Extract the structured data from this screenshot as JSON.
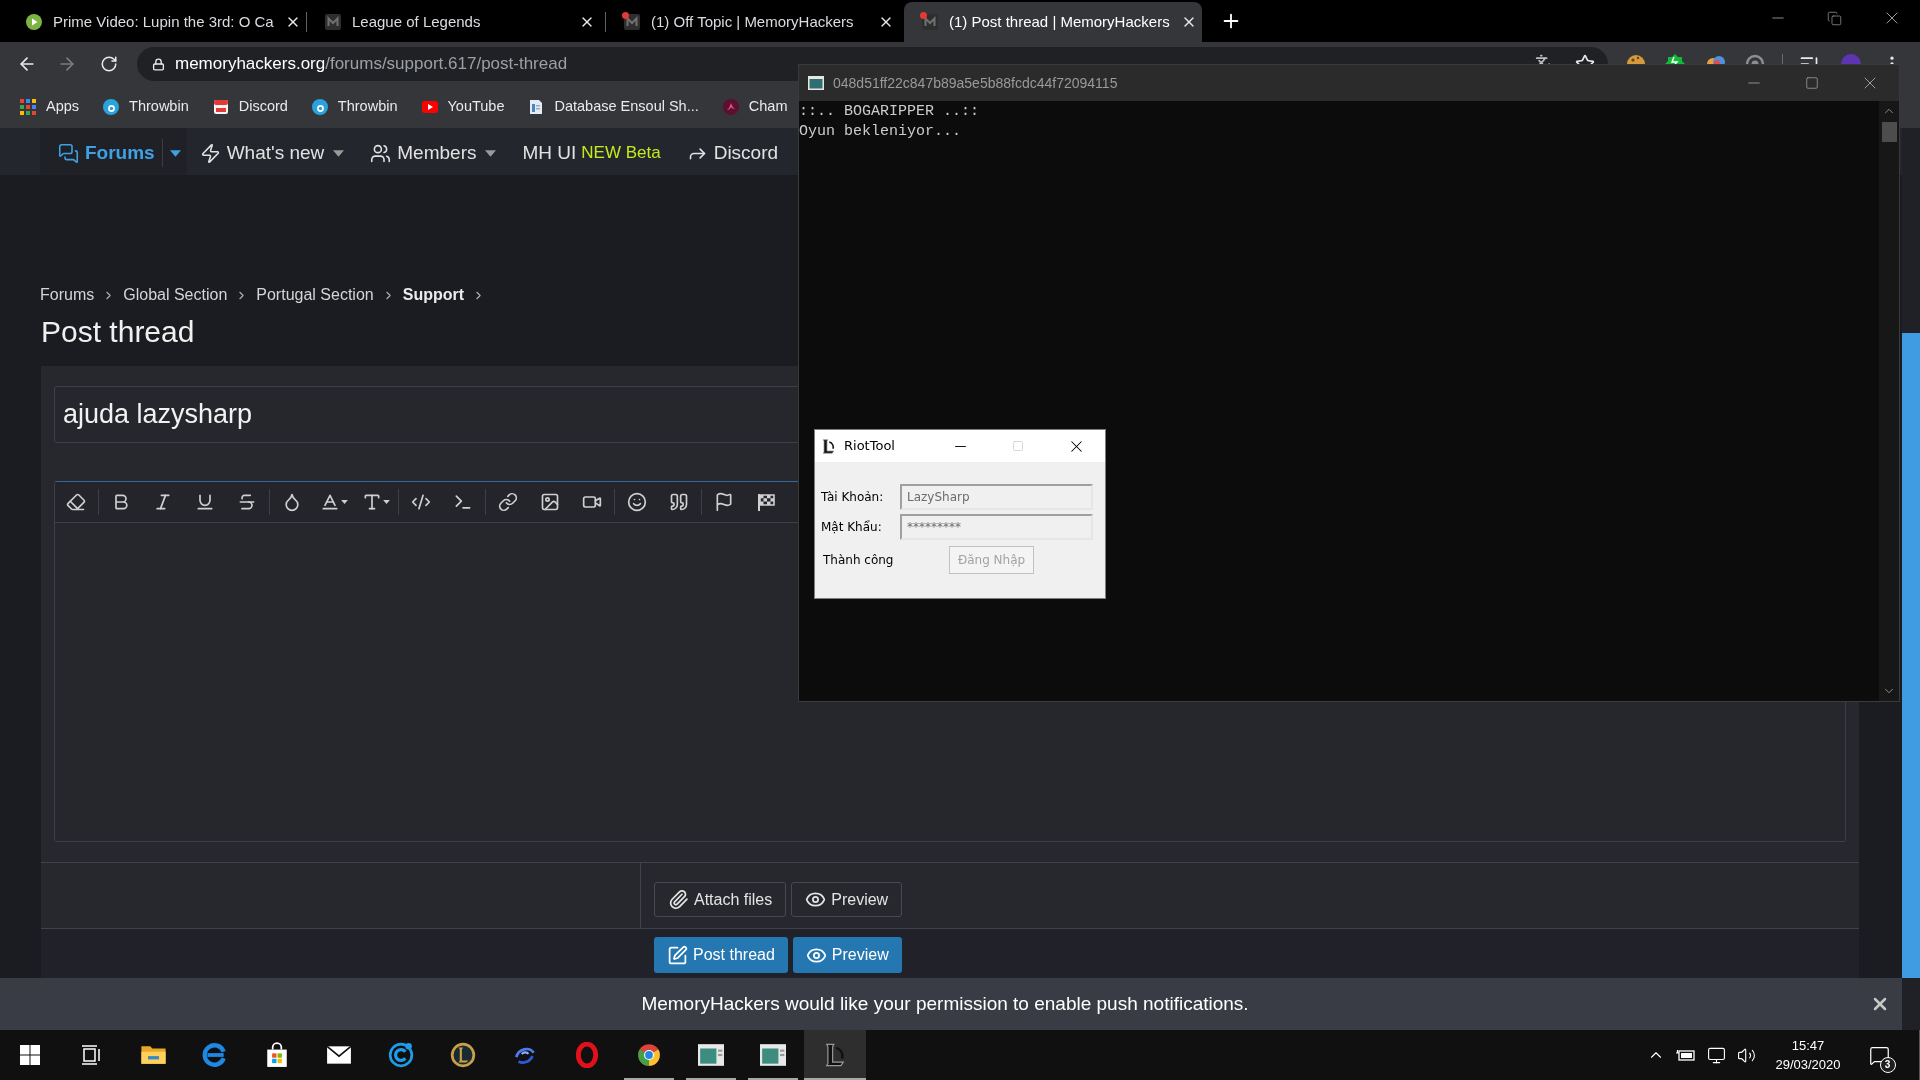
{
  "browser": {
    "tabs": [
      {
        "title": "Prime Video: Lupin the 3rd: O Ca",
        "kind": "play",
        "alert": false,
        "selected": false
      },
      {
        "title": "League of Legends",
        "kind": "mlogo",
        "alert": false,
        "selected": false
      },
      {
        "title": "(1) Off Topic | MemoryHackers",
        "kind": "mlogo",
        "alert": true,
        "selected": false
      },
      {
        "title": "(1) Post thread | MemoryHackers",
        "kind": "mlogo",
        "alert": true,
        "selected": true
      }
    ],
    "address": {
      "host": "memoryhackers.org",
      "path": "/forums/support.617/post-thread"
    },
    "bookmarks": [
      {
        "label": "Apps",
        "kind": "grid"
      },
      {
        "label": "Throwbin",
        "kind": "bcircle"
      },
      {
        "label": "Discord",
        "kind": "calendar"
      },
      {
        "label": "Throwbin",
        "kind": "bcircle"
      },
      {
        "label": "YouTube",
        "kind": "video"
      },
      {
        "label": "Database Ensoul Sh...",
        "kind": "document"
      },
      {
        "label": "Cham",
        "kind": "bird"
      }
    ]
  },
  "forum": {
    "nav": [
      {
        "label": "Forums",
        "kind": "chat",
        "selected": true,
        "dropdown": true
      },
      {
        "label": "What's new",
        "kind": "bolt",
        "selected": false,
        "dropdown": true
      },
      {
        "label": "Members",
        "kind": "users",
        "selected": false,
        "dropdown": true
      },
      {
        "label": "MH UI",
        "kind": "text",
        "badge": "NEW Beta",
        "selected": false,
        "dropdown": false
      },
      {
        "label": "Discord",
        "kind": "share",
        "selected": false,
        "dropdown": false
      }
    ],
    "breadcrumb": [
      {
        "label": "Forums",
        "current": false
      },
      {
        "label": "Global Section",
        "current": false
      },
      {
        "label": "Portugal Section",
        "current": false
      },
      {
        "label": "Support",
        "current": true
      }
    ],
    "page_title": "Post thread",
    "thread_title": {
      "value": "ajuda lazysharp"
    },
    "attachment_buttons": [
      {
        "label": "Attach files",
        "kind": "paperclip"
      },
      {
        "label": "Preview",
        "kind": "eye"
      }
    ],
    "submit_buttons": [
      {
        "label": "Post thread",
        "kind": "edit"
      },
      {
        "label": "Preview",
        "kind": "eye"
      }
    ]
  },
  "push_prompt": {
    "message": "MemoryHackers would like your permission to enable push notifications."
  },
  "console": {
    "title": "048d51ff22c847b89a5e5b88fcdc44f72094115",
    "lines": [
      "::.. BOGARIPPER ..::",
      "Oyun bekleniyor..."
    ]
  },
  "riottool": {
    "title": "RiotTool",
    "fields": [
      {
        "label": "Tài Khoản:",
        "value": "LazySharp",
        "disabled": true
      },
      {
        "label": "Mật Khẩu:",
        "value": "*********",
        "disabled": true
      }
    ],
    "status": "Thành công",
    "button": {
      "label": "Đăng Nhập",
      "disabled": true
    }
  },
  "taskbar": {
    "apps": [
      {
        "kind": "folder",
        "running": false,
        "selected": false
      },
      {
        "kind": "ecircle",
        "running": false,
        "selected": false
      },
      {
        "kind": "bag",
        "running": false,
        "selected": false
      },
      {
        "kind": "envelope",
        "running": false,
        "selected": false
      },
      {
        "kind": "cring",
        "running": false,
        "selected": false
      },
      {
        "kind": "shield",
        "running": false,
        "selected": false
      },
      {
        "kind": "swirl",
        "running": false,
        "selected": false
      },
      {
        "kind": "ring",
        "running": false,
        "selected": false
      },
      {
        "kind": "wheel",
        "running": true,
        "selected": false
      },
      {
        "kind": "window",
        "running": true,
        "selected": false
      },
      {
        "kind": "window",
        "running": true,
        "selected": false
      },
      {
        "kind": "emblem",
        "running": true,
        "selected": true
      }
    ],
    "clock": {
      "time": "15:47",
      "date": "29/03/2020"
    },
    "notification_count": "3"
  }
}
